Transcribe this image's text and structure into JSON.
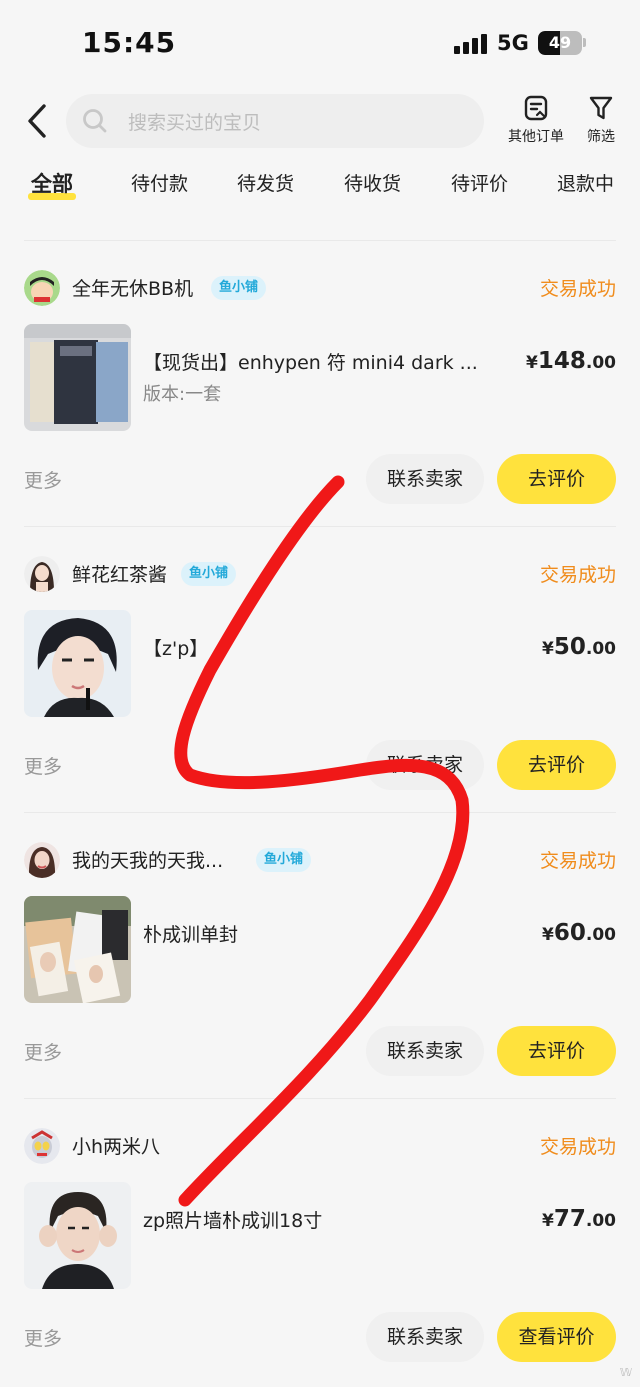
{
  "status_bar": {
    "time": "15:45",
    "network": "5G",
    "battery": "49",
    "battery_level": 0.49
  },
  "header": {
    "search_placeholder": "搜索买过的宝贝",
    "other_orders": "其他订单",
    "filter": "筛选"
  },
  "tabs": [
    {
      "label": "全部",
      "active": true
    },
    {
      "label": "待付款"
    },
    {
      "label": "待发货"
    },
    {
      "label": "待收货"
    },
    {
      "label": "待评价"
    },
    {
      "label": "退款中"
    }
  ],
  "orders": [
    {
      "shop": "全年无休BB机",
      "badge": "鱼小铺",
      "status": "交易成功",
      "title": "【现货出】enhypen 符 mini4 dark ...",
      "spec": "版本:一套",
      "price_currency": "¥",
      "price_int": "148",
      "price_dec": ".00",
      "more": "更多",
      "contact": "联系卖家",
      "action": "去评价"
    },
    {
      "shop": "鲜花红茶酱",
      "badge": "鱼小铺",
      "status": "交易成功",
      "title": "【z'p】",
      "spec": "",
      "price_currency": "¥",
      "price_int": "50",
      "price_dec": ".00",
      "more": "更多",
      "contact": "联系卖家",
      "action": "去评价"
    },
    {
      "shop": "我的天我的天我...",
      "badge": "鱼小铺",
      "status": "交易成功",
      "title": "朴成训单封",
      "spec": "",
      "price_currency": "¥",
      "price_int": "60",
      "price_dec": ".00",
      "more": "更多",
      "contact": "联系卖家",
      "action": "去评价"
    },
    {
      "shop": "小h两米八",
      "badge": "",
      "status": "交易成功",
      "title": "zp照片墙朴成训18寸",
      "spec": "",
      "price_currency": "¥",
      "price_int": "77",
      "price_dec": ".00",
      "more": "更多",
      "contact": "联系卖家",
      "action": "查看评价"
    }
  ],
  "colors": {
    "accent_yellow": "#ffe23d",
    "status_orange": "#f08c1c",
    "badge_blue": "#23a9d9",
    "scribble_red": "#f01818"
  }
}
